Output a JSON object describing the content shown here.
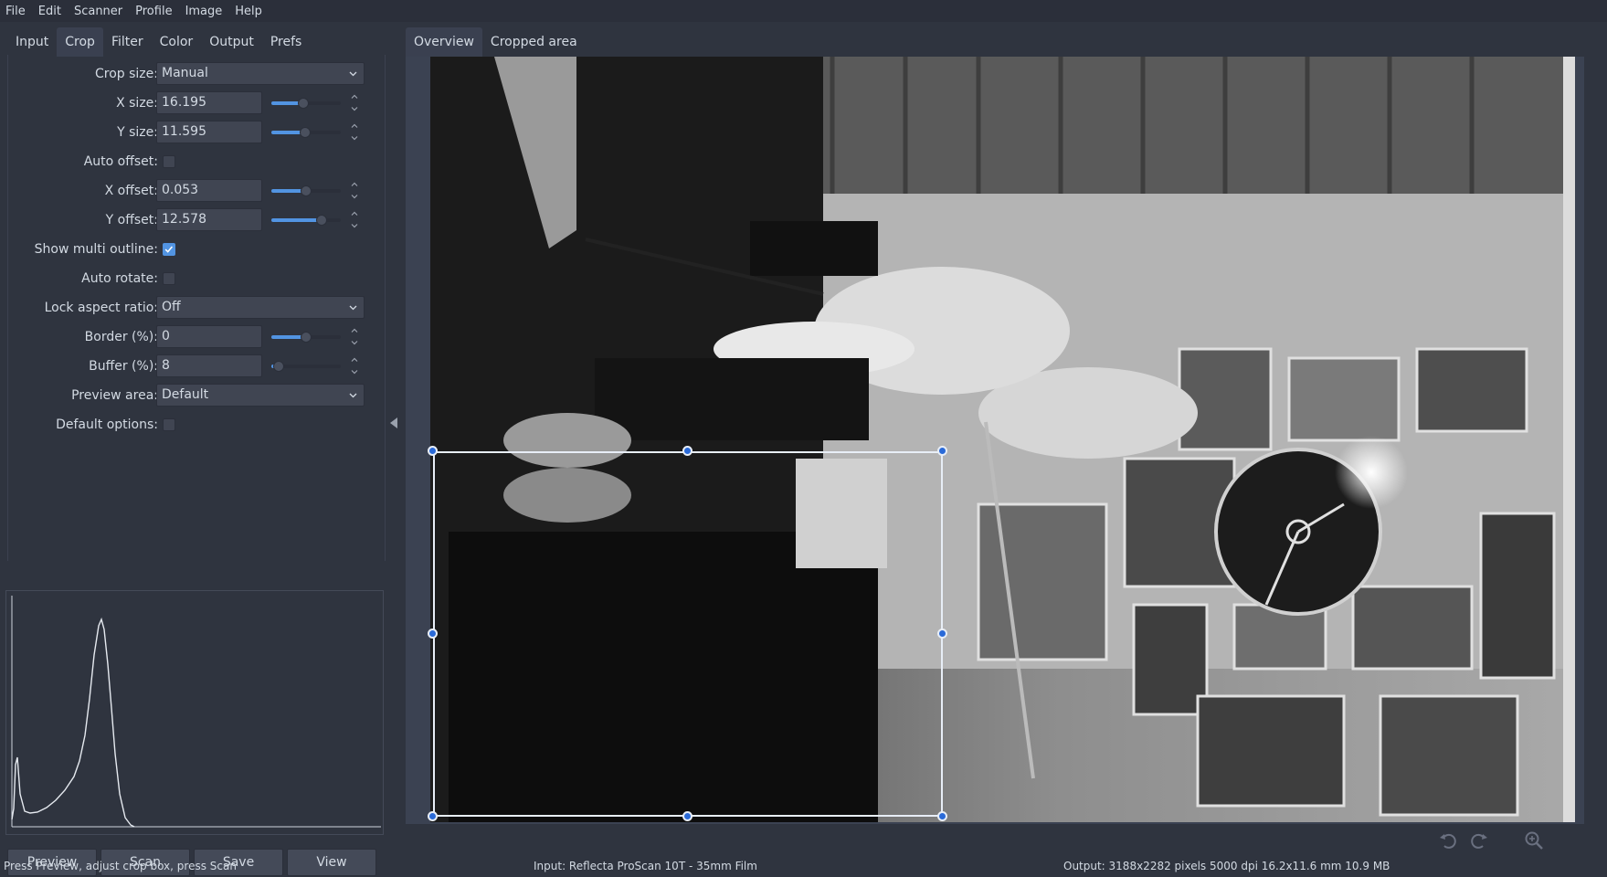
{
  "menubar": {
    "items": [
      "File",
      "Edit",
      "Scanner",
      "Profile",
      "Image",
      "Help"
    ]
  },
  "left_tabs": [
    "Input",
    "Crop",
    "Filter",
    "Color",
    "Output",
    "Prefs"
  ],
  "left_tabs_active": "Crop",
  "crop_form": {
    "crop_size": {
      "label": "Crop size:",
      "value": "Manual"
    },
    "x_size": {
      "label": "X size:",
      "value": "16.195",
      "slider_fraction": 0.46
    },
    "y_size": {
      "label": "Y size:",
      "value": "11.595",
      "slider_fraction": 0.49
    },
    "auto_offset": {
      "label": "Auto offset:",
      "checked": false
    },
    "x_offset": {
      "label": "X offset:",
      "value": "0.053",
      "slider_fraction": 0.5
    },
    "y_offset": {
      "label": "Y offset:",
      "value": "12.578",
      "slider_fraction": 0.72
    },
    "show_multi_outline": {
      "label": "Show multi outline:",
      "checked": true
    },
    "auto_rotate": {
      "label": "Auto rotate:",
      "checked": false
    },
    "lock_aspect_ratio": {
      "label": "Lock aspect ratio:",
      "value": "Off"
    },
    "border": {
      "label": "Border (%):",
      "value": "0",
      "slider_fraction": 0.5
    },
    "buffer": {
      "label": "Buffer (%):",
      "value": "8",
      "slider_fraction": 0.1
    },
    "preview_area": {
      "label": "Preview area:",
      "value": "Default"
    },
    "default_options": {
      "label": "Default options:",
      "checked": false
    }
  },
  "buttons": {
    "preview": "Preview",
    "scan": "Scan",
    "save": "Save",
    "view": "View"
  },
  "right_tabs": [
    "Overview",
    "Cropped area"
  ],
  "right_tabs_active": "Overview",
  "status": {
    "left": "Press Preview, adjust crop box, press Scan",
    "center": "Input: Reflecta ProScan 10T - 35mm Film",
    "right": "Output: 3188x2282 pixels 5000 dpi 16.2x11.6 mm 10.9 MB"
  },
  "icons": {
    "rotate_left": "rotate-left-icon",
    "rotate_right": "rotate-right-icon",
    "zoom": "zoom-in-icon",
    "collapse": "collapse-left-arrow-icon",
    "dropdown": "chevron-down-icon"
  },
  "colors": {
    "accent": "#5294e2",
    "window": "#2f343f",
    "handle": "#2a6ad8"
  }
}
